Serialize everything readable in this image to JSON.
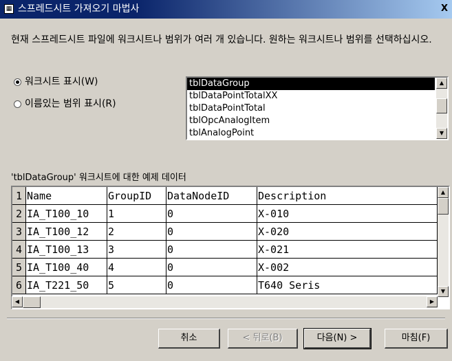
{
  "window": {
    "title": "스프레드시트 가져오기 마법사",
    "close_label": "X"
  },
  "intro": "현재 스프레드시트 파일에 워크시트나 범위가 여러 개 있습니다. 원하는 워크시트나 범위를 선택하십시오.",
  "options": [
    {
      "label": "워크시트 표시(W)",
      "selected": true
    },
    {
      "label": "이름있는 범위 표시(R)",
      "selected": false
    }
  ],
  "sheet_list": {
    "items": [
      "tblDataGroup",
      "tblDataPointTotalXX",
      "tblDataPointTotal",
      "tblOpcAnalogItem",
      "tblAnalogPoint"
    ],
    "selected_index": 0
  },
  "sample": {
    "label": "'tblDataGroup' 워크시트에 대한 예제 데이터",
    "rows": [
      {
        "num": "1",
        "cells": [
          "Name",
          "GroupID",
          "DataNodeID",
          "Description"
        ]
      },
      {
        "num": "2",
        "cells": [
          "IA_T100_10",
          "1",
          "0",
          "X-010"
        ]
      },
      {
        "num": "3",
        "cells": [
          "IA_T100_12",
          "2",
          "0",
          "X-020"
        ]
      },
      {
        "num": "4",
        "cells": [
          "IA_T100_13",
          "3",
          "0",
          "X-021"
        ]
      },
      {
        "num": "5",
        "cells": [
          "IA_T100_40",
          "4",
          "0",
          "X-002"
        ]
      },
      {
        "num": "6",
        "cells": [
          "IA_T221_50",
          "5",
          "0",
          "T640 Seris"
        ]
      }
    ]
  },
  "buttons": {
    "cancel": "취소",
    "back": "< 뒤로(B)",
    "next": "다음(N) >",
    "finish": "마침(F)"
  }
}
